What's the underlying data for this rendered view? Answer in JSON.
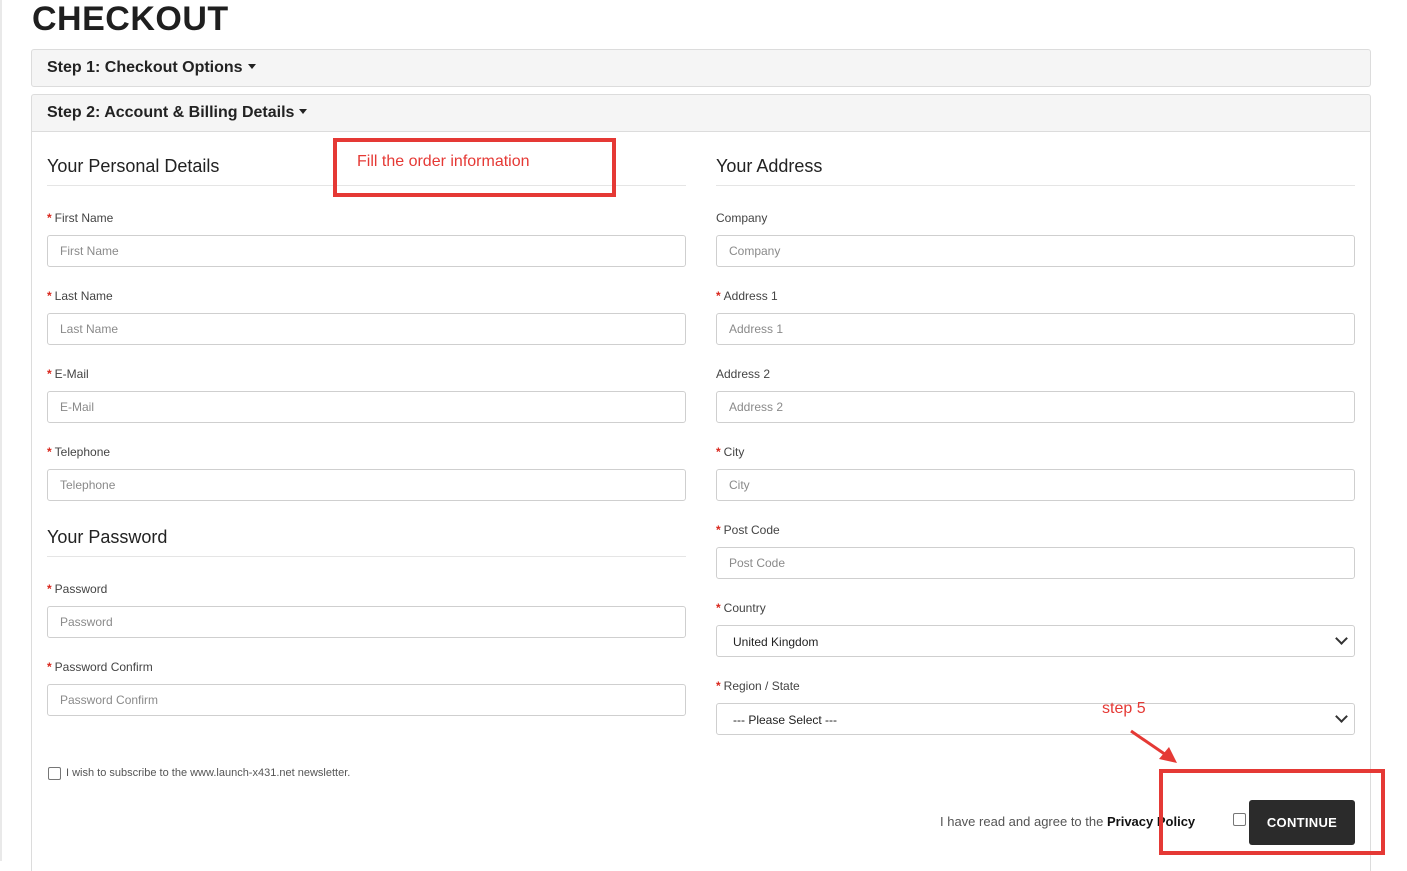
{
  "page": {
    "title": "CHECKOUT"
  },
  "steps": [
    {
      "label": "Step 1: Checkout Options"
    },
    {
      "label": "Step 2: Account & Billing Details"
    }
  ],
  "personal": {
    "title": "Your Personal Details",
    "fields": [
      {
        "label": "First Name",
        "placeholder": "First Name",
        "required": true
      },
      {
        "label": "Last Name",
        "placeholder": "Last Name",
        "required": true
      },
      {
        "label": "E-Mail",
        "placeholder": "E-Mail",
        "required": true
      },
      {
        "label": "Telephone",
        "placeholder": "Telephone",
        "required": true
      }
    ]
  },
  "password": {
    "title": "Your Password",
    "fields": [
      {
        "label": "Password",
        "placeholder": "Password",
        "required": true
      },
      {
        "label": "Password Confirm",
        "placeholder": "Password Confirm",
        "required": true
      }
    ]
  },
  "address": {
    "title": "Your Address",
    "fields": [
      {
        "label": "Company",
        "placeholder": "Company",
        "required": false
      },
      {
        "label": "Address 1",
        "placeholder": "Address 1",
        "required": true
      },
      {
        "label": "Address 2",
        "placeholder": "Address 2",
        "required": false
      },
      {
        "label": "City",
        "placeholder": "City",
        "required": true
      },
      {
        "label": "Post Code",
        "placeholder": "Post Code",
        "required": true
      }
    ],
    "country": {
      "label": "Country",
      "value": "United Kingdom"
    },
    "region": {
      "label": "Region / State",
      "value": "--- Please Select ---"
    }
  },
  "newsletter": {
    "label": "I wish to subscribe to the www.launch-x431.net newsletter."
  },
  "agree": {
    "prefix": "I have read and agree to the",
    "link": "Privacy Policy"
  },
  "continue": {
    "label": "CONTINUE"
  },
  "annotations": {
    "fill_text": "Fill the order information",
    "step5": "step 5",
    "color": "#e53935"
  }
}
